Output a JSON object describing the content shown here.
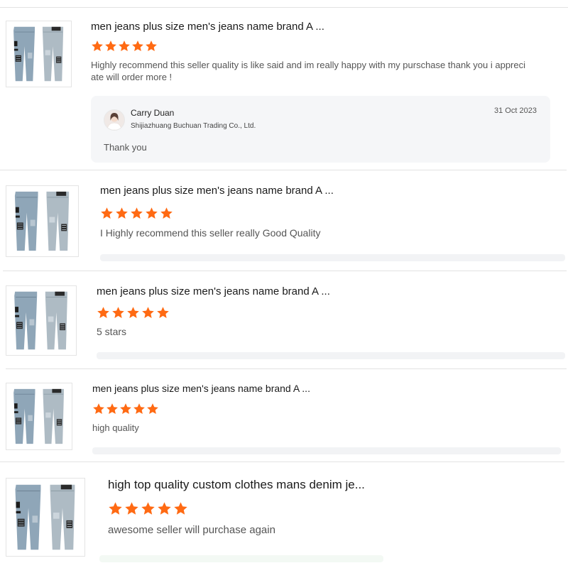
{
  "colors": {
    "star": "#ff6a13",
    "reply_bg": "#f5f6f8"
  },
  "reviews": [
    {
      "title": "men jeans plus size men's jeans name brand A ...",
      "rating": 5,
      "text": "Highly recommend this seller quality is like said and im really happy with my purschase  thank you i appreci ate will order more !",
      "reply": {
        "seller_name": "Carry Duan",
        "company": "Shijiazhuang Buchuan Trading Co., Ltd.",
        "date": "31 Oct 2023",
        "text": "Thank you"
      }
    },
    {
      "title": "men jeans plus size men's jeans name brand A ...",
      "rating": 5,
      "text": "I Highly recommend this seller really Good Quality"
    },
    {
      "title": "men jeans plus size men's jeans name brand A ...",
      "rating": 5,
      "text": "5 stars"
    },
    {
      "title": "men jeans plus size men's jeans name brand A ...",
      "rating": 5,
      "text": "high quality"
    },
    {
      "title": "high top quality custom clothes mans denim je...",
      "rating": 5,
      "text": "awesome seller will purchase again"
    }
  ]
}
